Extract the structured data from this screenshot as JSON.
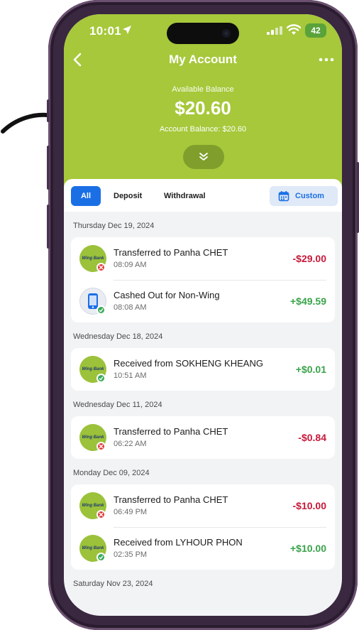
{
  "status_bar": {
    "time": "10:01",
    "battery": "42"
  },
  "header": {
    "title": "My Account",
    "available_balance_label": "Available Balance",
    "available_balance": "$20.60",
    "account_balance_text": "Account Balance: $20.60"
  },
  "tabs": {
    "all": "All",
    "deposit": "Deposit",
    "withdrawal": "Withdrawal",
    "custom": "Custom"
  },
  "avatar_brand": "Wing Bank",
  "transactions": [
    {
      "date": "Thursday Dec 19, 2024",
      "items": [
        {
          "title": "Transferred to Panha CHET",
          "time": "08:09 AM",
          "amount": "-$29.00"
        },
        {
          "title": "Cashed Out for Non-Wing",
          "time": "08:08 AM",
          "amount": "+$49.59"
        }
      ]
    },
    {
      "date": "Wednesday Dec 18, 2024",
      "items": [
        {
          "title": "Received from SOKHENG KHEANG",
          "time": "10:51 AM",
          "amount": "+$0.01"
        }
      ]
    },
    {
      "date": "Wednesday Dec 11, 2024",
      "items": [
        {
          "title": "Transferred to Panha CHET",
          "time": "06:22 AM",
          "amount": "-$0.84"
        }
      ]
    },
    {
      "date": "Monday Dec 09, 2024",
      "items": [
        {
          "title": "Transferred to Panha CHET",
          "time": "06:49 PM",
          "amount": "-$10.00"
        },
        {
          "title": "Received from LYHOUR PHON",
          "time": "02:35 PM",
          "amount": "+$10.00"
        }
      ]
    },
    {
      "date": "Saturday Nov 23, 2024",
      "items": []
    }
  ],
  "colors": {
    "header": "#a6c83a",
    "accent": "#1b6fe5",
    "negative": "#c7193a",
    "positive": "#3aa34a"
  }
}
